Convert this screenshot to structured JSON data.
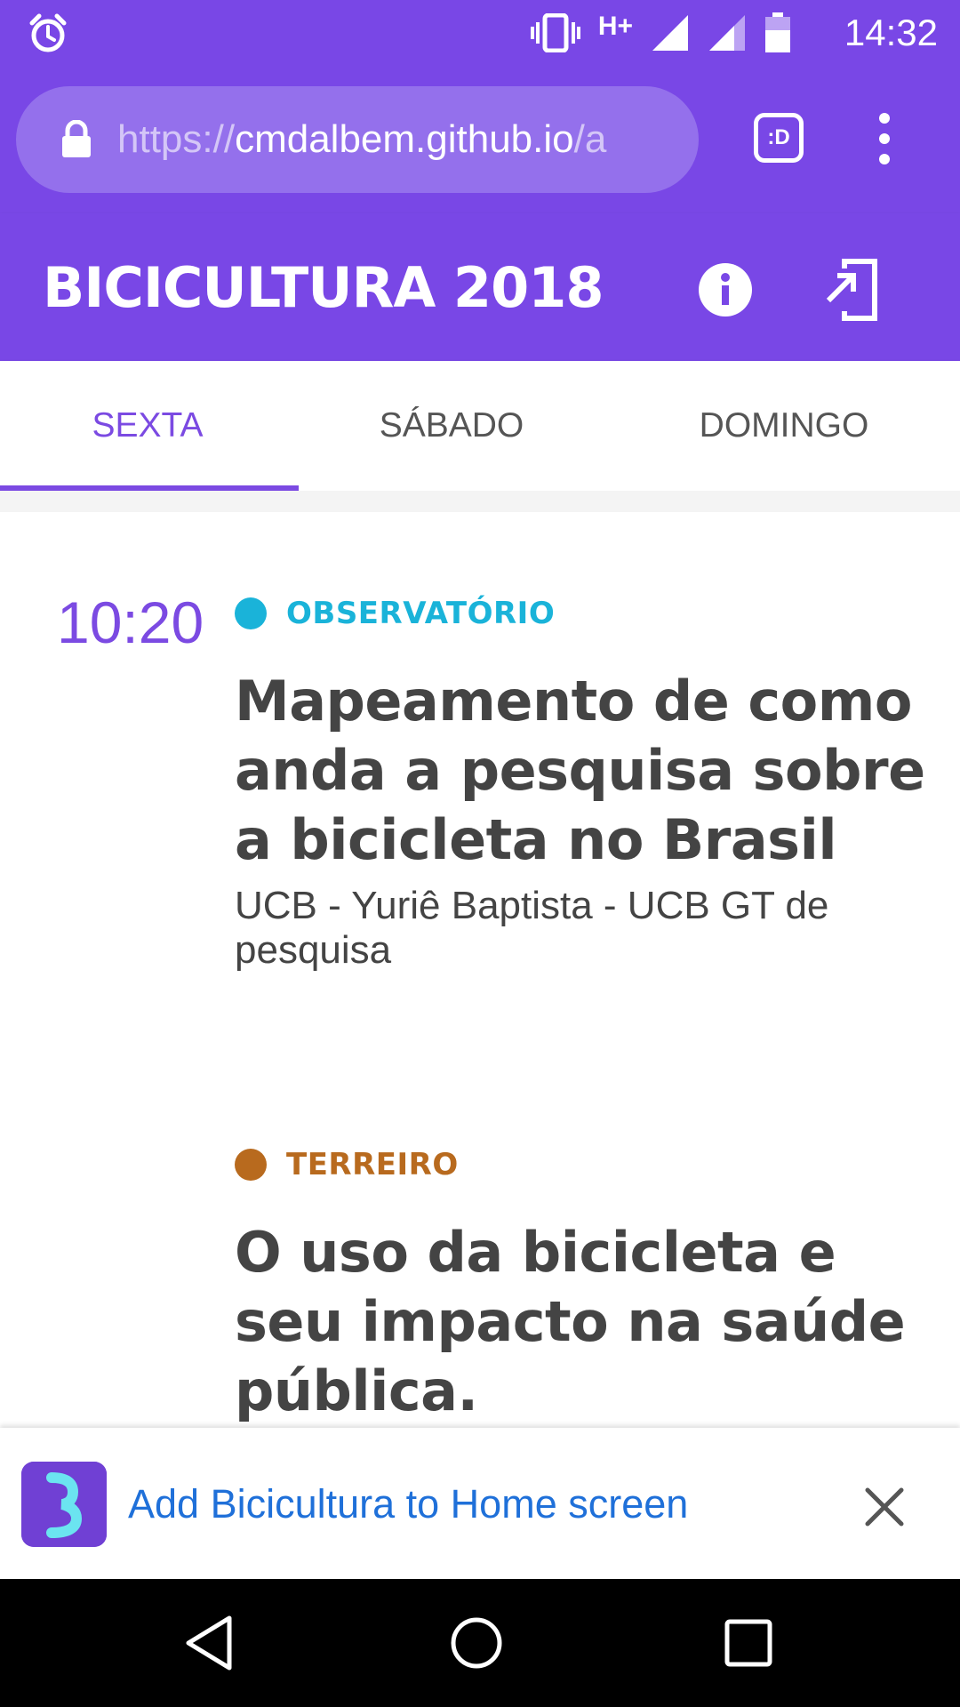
{
  "status_bar": {
    "network": "H+",
    "time": "14:32",
    "icons": [
      "alarm-icon",
      "vibrate-icon",
      "signal-icon",
      "signal-icon",
      "battery-icon"
    ]
  },
  "browser": {
    "url_scheme": "https://",
    "url_host": "cmdalbem.github.io",
    "url_path": "/a",
    "tab_switcher_label": ":D"
  },
  "app": {
    "title": "BICICULTURA 2018",
    "accent": "#7947e6"
  },
  "tabs": [
    {
      "label": "SEXTA",
      "active": true
    },
    {
      "label": "SÁBADO",
      "active": false
    },
    {
      "label": "DOMINGO",
      "active": false
    }
  ],
  "schedule": {
    "time": "10:20",
    "events": [
      {
        "venue": "OBSERVATÓRIO",
        "venue_color": "#1ab3d9",
        "title": "Mapeamento de como anda a pesquisa sobre a bicicleta no Brasil",
        "speaker": "UCB - Yuriê Baptista - UCB GT de pesquisa"
      },
      {
        "venue": "TERREIRO",
        "venue_color": "#b86a1e",
        "title": "O uso da bicicleta e seu impacto na saúde pública.",
        "speaker": ""
      }
    ]
  },
  "a2hs": {
    "text": "Add Bicicultura to Home screen"
  }
}
